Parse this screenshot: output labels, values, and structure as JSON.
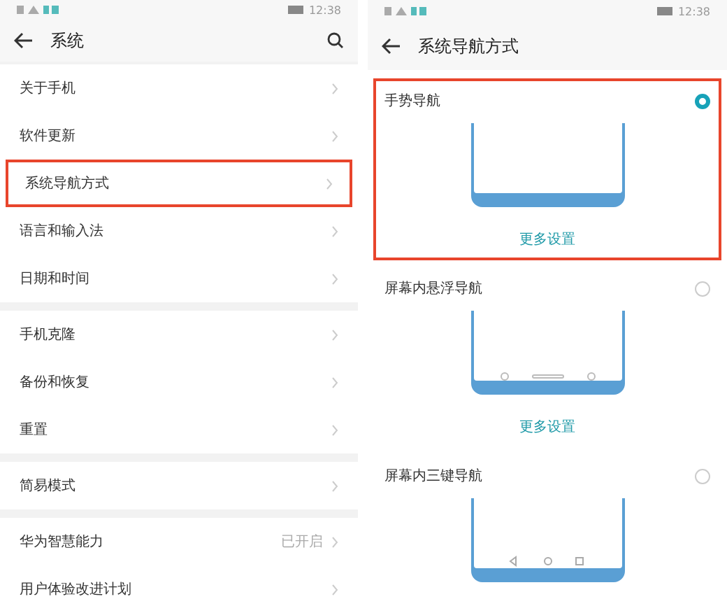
{
  "left_screen": {
    "status_bar": {
      "time": "12:38"
    },
    "header": {
      "title": "系统"
    },
    "sections": [
      {
        "items": [
          {
            "label": "关于手机",
            "highlighted": false
          },
          {
            "label": "软件更新",
            "highlighted": false
          },
          {
            "label": "系统导航方式",
            "highlighted": true
          },
          {
            "label": "语言和输入法",
            "highlighted": false
          },
          {
            "label": "日期和时间",
            "highlighted": false
          }
        ]
      },
      {
        "items": [
          {
            "label": "手机克隆",
            "highlighted": false
          },
          {
            "label": "备份和恢复",
            "highlighted": false
          },
          {
            "label": "重置",
            "highlighted": false
          }
        ]
      },
      {
        "items": [
          {
            "label": "简易模式",
            "highlighted": false
          }
        ]
      },
      {
        "items": [
          {
            "label": "华为智慧能力",
            "value": "已开启",
            "highlighted": false
          },
          {
            "label": "用户体验改进计划",
            "highlighted": false
          }
        ]
      }
    ]
  },
  "right_screen": {
    "status_bar": {
      "time": "12:38"
    },
    "header": {
      "title": "系统导航方式"
    },
    "options": [
      {
        "kind": "gesture",
        "label": "手势导航",
        "selected": true,
        "highlighted": true,
        "more_settings": "更多设置"
      },
      {
        "kind": "floating",
        "label": "屏幕内悬浮导航",
        "selected": false,
        "highlighted": false,
        "more_settings": "更多设置"
      },
      {
        "kind": "three-key",
        "label": "屏幕内三键导航",
        "selected": false,
        "highlighted": false
      }
    ]
  }
}
